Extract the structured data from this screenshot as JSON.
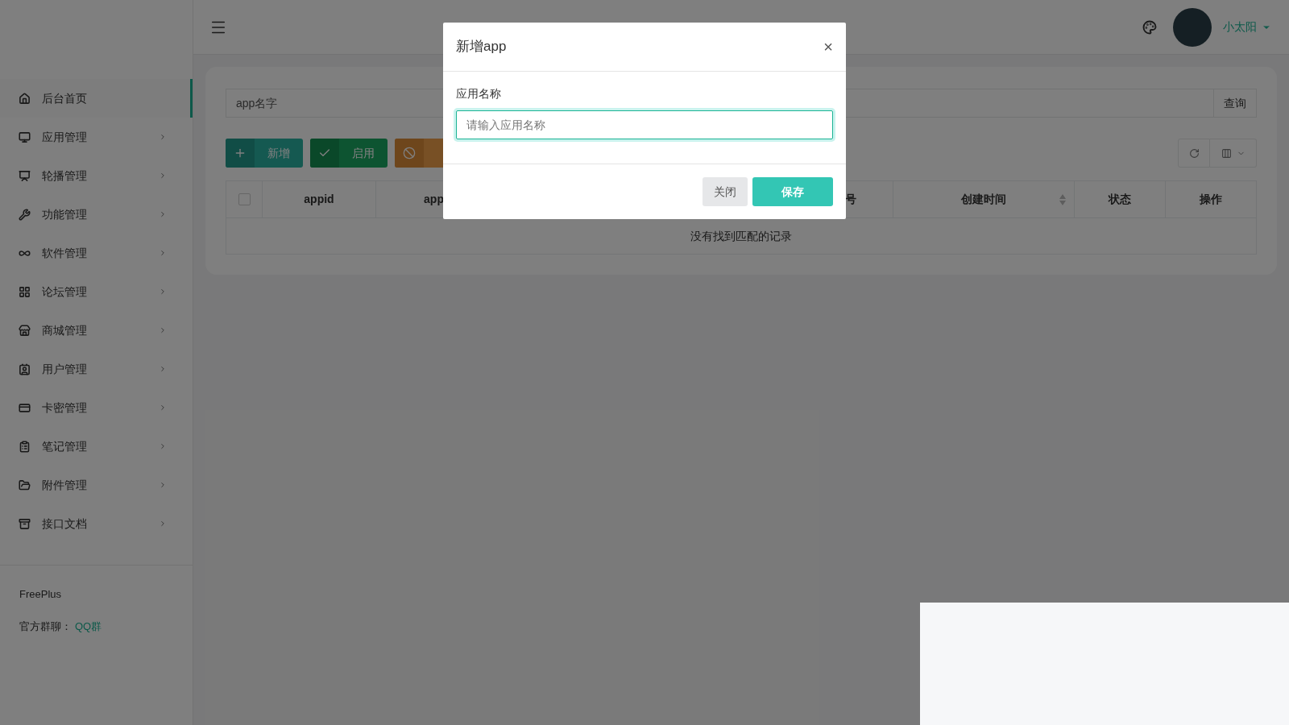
{
  "sidebar": {
    "items": [
      {
        "label": "后台首页",
        "selected": true,
        "has_submenu": false
      },
      {
        "label": "应用管理",
        "selected": false,
        "has_submenu": true
      },
      {
        "label": "轮播管理",
        "selected": false,
        "has_submenu": true
      },
      {
        "label": "功能管理",
        "selected": false,
        "has_submenu": true
      },
      {
        "label": "软件管理",
        "selected": false,
        "has_submenu": true
      },
      {
        "label": "论坛管理",
        "selected": false,
        "has_submenu": true
      },
      {
        "label": "商城管理",
        "selected": false,
        "has_submenu": true
      },
      {
        "label": "用户管理",
        "selected": false,
        "has_submenu": true
      },
      {
        "label": "卡密管理",
        "selected": false,
        "has_submenu": true
      },
      {
        "label": "笔记管理",
        "selected": false,
        "has_submenu": true
      },
      {
        "label": "附件管理",
        "selected": false,
        "has_submenu": true
      },
      {
        "label": "接口文档",
        "selected": false,
        "has_submenu": true
      }
    ],
    "footer": {
      "brand": "FreePlus",
      "group_label": "官方群聊：",
      "group_link": "QQ群"
    }
  },
  "header": {
    "user_name": "小太阳"
  },
  "search": {
    "placeholder": "app名字",
    "button": "查询"
  },
  "toolbar": {
    "buttons": [
      {
        "kind": "add",
        "label": "新增"
      },
      {
        "kind": "enable",
        "label": "启用"
      },
      {
        "kind": "disable"
      }
    ]
  },
  "table": {
    "columns": [
      {
        "label": "appid",
        "sortable": false
      },
      {
        "label": "app",
        "sortable": false
      },
      {
        "label": "号",
        "sortable": false
      },
      {
        "label": "创建时间",
        "sortable": true
      },
      {
        "label": "状态",
        "sortable": false
      },
      {
        "label": "操作",
        "sortable": false
      }
    ],
    "select_all_checked": false,
    "empty_message": "没有找到匹配的记录"
  },
  "dialog": {
    "title": "新增app",
    "close": "×",
    "field_label": "应用名称",
    "placeholder": "请输入应用名称",
    "buttons": [
      {
        "kind": "secondary",
        "label": "关闭"
      },
      {
        "kind": "primary",
        "label": "保存"
      }
    ]
  }
}
